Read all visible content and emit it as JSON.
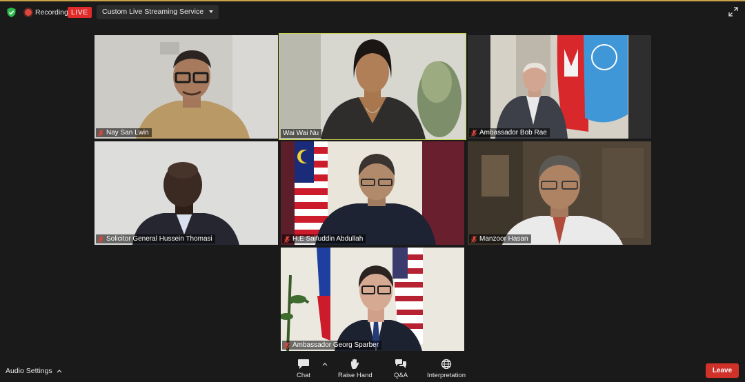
{
  "topbar": {
    "recording_label": "Recording",
    "live_label": "LIVE",
    "stream_label": "Custom Live Streaming Service"
  },
  "participants": [
    {
      "name": "Nay San Lwin"
    },
    {
      "name": "Wai Wai Nu"
    },
    {
      "name": "Ambassador Bob Rae"
    },
    {
      "name": "Solicitor General Hussein Thomasi"
    },
    {
      "name": "H.E Saifuddin Abdullah"
    },
    {
      "name": "Manzoor Hasan"
    },
    {
      "name": "Ambassador Georg Sparber"
    }
  ],
  "active_speaker": "Wai Wai Nu",
  "bottombar": {
    "audio_settings": "Audio Settings",
    "chat": "Chat",
    "raise_hand": "Raise Hand",
    "qa": "Q&A",
    "interpretation": "Interpretation",
    "leave": "Leave"
  },
  "colors": {
    "live": "#e12a2a",
    "leave": "#d0322a",
    "active_border": "#c8d24c",
    "muted_mic": "#e0463c"
  }
}
